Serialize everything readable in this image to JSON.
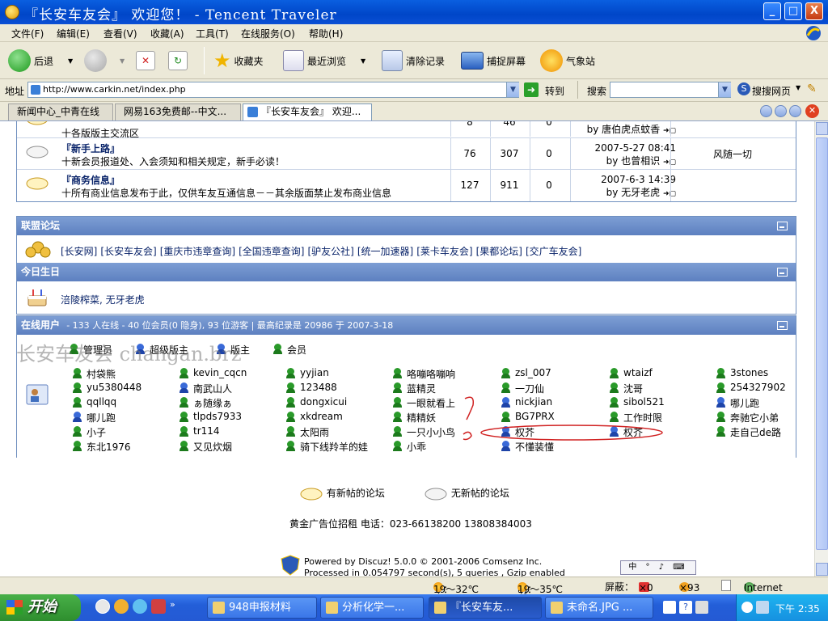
{
  "window": {
    "title": "『长安车友会』 欢迎您！ - Tencent Traveler",
    "buttons": [
      "_",
      "□",
      "X"
    ]
  },
  "menu": [
    "文件(F)",
    "编辑(E)",
    "查看(V)",
    "收藏(A)",
    "工具(T)",
    "在线服务(O)",
    "帮助(H)"
  ],
  "toolbar": {
    "back": "后退",
    "favorites": "收藏夹",
    "recent": "最近浏览",
    "clear": "清除记录",
    "capture": "捕捉屏幕",
    "weather": "气象站"
  },
  "address": {
    "label": "地址",
    "url": "http://www.carkin.net/index.php",
    "go": "转到",
    "search_label": "搜索",
    "search_web": "搜搜网页"
  },
  "tabs": [
    "新闻中心_中青在线",
    "网易163免费邮--中文...",
    "『长安车友会』 欢迎..."
  ],
  "forums": [
    {
      "name": "",
      "desc": "十各版版主交流区",
      "topics": "8",
      "posts": "46",
      "today": "0",
      "last_time": "",
      "last_by": "by 唐伯虎点蚊香",
      "moderator": ""
    },
    {
      "name": "『新手上路』",
      "desc": "十新会员报道处、入会须知和相关规定，新手必读！",
      "topics": "76",
      "posts": "307",
      "today": "0",
      "last_time": "2007-5-27 08:41",
      "last_by": "by 也曾相识",
      "moderator": "风随一切"
    },
    {
      "name": "『商务信息』",
      "desc": "十所有商业信息发布于此，仅供车友互通信息－－其余版面禁止发布商业信息",
      "topics": "127",
      "posts": "911",
      "today": "0",
      "last_time": "2007-6-3 14:39",
      "last_by": "by 无牙老虎",
      "moderator": ""
    }
  ],
  "alliance": {
    "title": "联盟论坛",
    "links": [
      "[长安网]",
      "[长安车友会]",
      "[重庆市违章查询]",
      "[全国违章查询]",
      "[驴友公社]",
      "[统一加速器]",
      "[莱卡车友会]",
      "[果都论坛]",
      "[交广车友会]"
    ]
  },
  "birthday": {
    "title": "今日生日",
    "names": "涪陵榨菜, 无牙老虎"
  },
  "online": {
    "title": "在线用户",
    "stats": "- 133 人在线 - 40 位会员(0 隐身), 93 位游客 | 最高纪录是 20986 于 2007-3-18",
    "legend": [
      "管理员",
      "超级版主",
      "版主",
      "会员"
    ],
    "watermark": "长安车友会 changan.brz",
    "users": [
      [
        "村袋熊",
        "kevin_cqcn",
        "yyjian",
        "咯嘣咯嘣响",
        "zsl_007",
        "wtaizf",
        "3stones"
      ],
      [
        "yu5380448",
        "南武山人",
        "123488",
        "蓝精灵",
        "一刀仙",
        "沈哥",
        "254327902"
      ],
      [
        "qqllqq",
        "ぁ随缘ぁ",
        "dongxicui",
        "一眼就看上",
        "nickjian",
        "sibol521",
        "哪儿跑"
      ],
      [
        "哪儿跑",
        "tlpds7933",
        "xkdream",
        "精精妖",
        "BG7PRX",
        "工作时限",
        "奔驰它小弟"
      ],
      [
        "小子",
        "tr114",
        "太阳雨",
        "一只小小鸟",
        "权芥",
        "权芥",
        "走自己de路"
      ],
      [
        "东北1976",
        "又见炊烟",
        "骑下线羚羊的娃",
        "小乖",
        "不懂装懂",
        "",
        ""
      ]
    ]
  },
  "footer": {
    "new_posts": "有新帖的论坛",
    "no_new_posts": "无新帖的论坛",
    "ad": "黄金广告位招租 电话：023-66138200 13808384003",
    "powered": "Powered by Discuz! 5.0.0",
    "copyright": "© 2001-2006 Comsenz Inc.",
    "processed": "Processed in 0.054797 second(s), 5 queries , Gzip enabled"
  },
  "status": {
    "today": "今：",
    "today_temp": "19～32℃",
    "tomorrow": "明：",
    "tomorrow_temp": "19～35℃",
    "block": "屏蔽：",
    "block1": "×0",
    "block2": "×93",
    "zone": "Internet"
  },
  "taskbar": {
    "start": "开始",
    "tasks": [
      "948申报材料",
      "分析化学一...",
      "『长安车友...",
      "未命名.JPG ..."
    ],
    "clock": "下午 2:35"
  }
}
